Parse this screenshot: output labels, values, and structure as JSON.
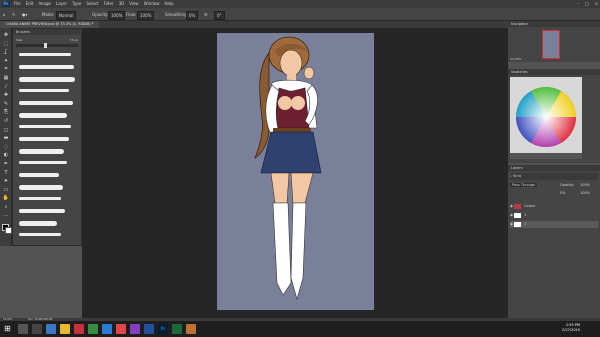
{
  "app": {
    "logo": "Ps",
    "name": "Adobe Photoshop"
  },
  "menubar": {
    "items": [
      "File",
      "Edit",
      "Image",
      "Layer",
      "Type",
      "Select",
      "Filter",
      "3D",
      "View",
      "Window",
      "Help"
    ],
    "controls": [
      "–",
      "□",
      "×"
    ]
  },
  "options": {
    "mode_label": "Mode:",
    "mode_value": "Normal",
    "opacity_label": "Opacity:",
    "opacity_value": "100%",
    "flow_label": "Flow:",
    "flow_value": "100%",
    "smoothing_label": "Smoothing:",
    "smoothing_value": "0%",
    "angle_value": "0°"
  },
  "document": {
    "tab_title": "CHARA ANIME PREVIEW.psd @ 33.3% (1, RGB/8) *"
  },
  "brushes_panel": {
    "title": "Brushes",
    "size_label": "Size",
    "size_value": "73 px",
    "stroke_count": 16
  },
  "tools": [
    "move-icon",
    "marquee-icon",
    "lasso-icon",
    "quick-select-icon",
    "crop-icon",
    "frame-icon",
    "eyedropper-icon",
    "healing-icon",
    "brush-icon",
    "stamp-icon",
    "history-brush-icon",
    "eraser-icon",
    "gradient-icon",
    "blur-icon",
    "dodge-icon",
    "pen-icon",
    "type-icon",
    "path-select-icon",
    "shape-icon",
    "hand-icon",
    "zoom-icon",
    "more-icon"
  ],
  "navigator": {
    "title": "Navigator",
    "zoom": "33.33%"
  },
  "swatches": {
    "title": "Swatches"
  },
  "layers": {
    "title": "Layers",
    "kind_label": "Kind",
    "blend_value": "Pass Through",
    "opacity_label": "Opacity:",
    "opacity_value": "100%",
    "fill_label": "Fill:",
    "fill_value": "100%",
    "rows": [
      {
        "name": "Colour",
        "color": "#b93a46"
      },
      {
        "name": "1",
        "color": "#ffffff"
      },
      {
        "name": "1",
        "color": "#ffffff"
      }
    ]
  },
  "statusbar": {
    "zoom": "33.33%",
    "doc": "Doc: 35.6M/369.4M"
  },
  "taskbar": {
    "time": "2:55 PM",
    "date": "2/27/2019"
  },
  "colors": {
    "accent": "#31a8ff",
    "canvas": "#7a8099",
    "workspace": "#262626"
  }
}
